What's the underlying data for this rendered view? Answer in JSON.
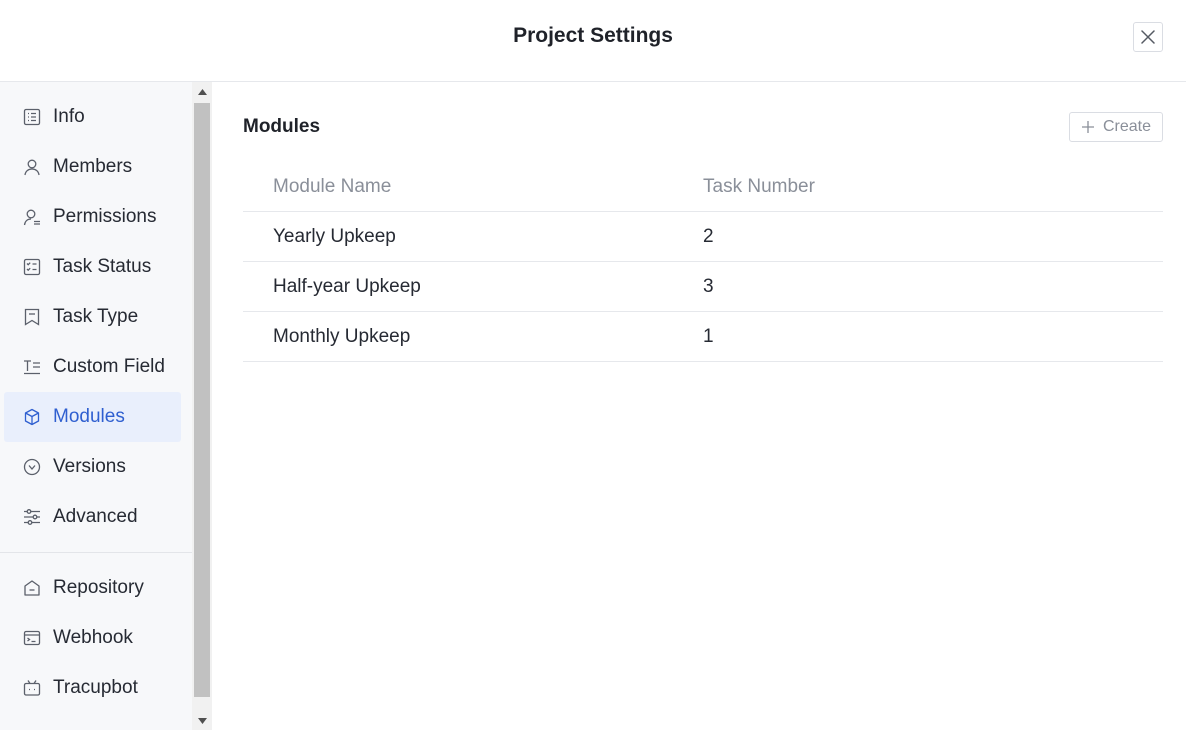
{
  "header": {
    "title": "Project Settings",
    "close_icon": "close-icon"
  },
  "sidebar": {
    "items": [
      {
        "label": "Info",
        "icon": "info-list-icon",
        "active": false
      },
      {
        "label": "Members",
        "icon": "user-icon",
        "active": false
      },
      {
        "label": "Permissions",
        "icon": "user-permission-icon",
        "active": false
      },
      {
        "label": "Task Status",
        "icon": "task-status-icon",
        "active": false
      },
      {
        "label": "Task Type",
        "icon": "bookmark-icon",
        "active": false
      },
      {
        "label": "Custom Field",
        "icon": "custom-field-icon",
        "active": false
      },
      {
        "label": "Modules",
        "icon": "cube-icon",
        "active": true
      },
      {
        "label": "Versions",
        "icon": "chevron-circle-icon",
        "active": false
      },
      {
        "label": "Advanced",
        "icon": "sliders-icon",
        "active": false
      }
    ],
    "secondary_items": [
      {
        "label": "Repository",
        "icon": "repository-icon"
      },
      {
        "label": "Webhook",
        "icon": "terminal-icon"
      },
      {
        "label": "Tracupbot",
        "icon": "bot-icon"
      }
    ]
  },
  "main": {
    "section_title": "Modules",
    "create_label": "Create",
    "table": {
      "columns": [
        "Module Name",
        "Task Number"
      ],
      "rows": [
        {
          "name": "Yearly Upkeep",
          "tasks": "2"
        },
        {
          "name": "Half-year Upkeep",
          "tasks": "3"
        },
        {
          "name": "Monthly Upkeep",
          "tasks": "1"
        }
      ]
    }
  },
  "colors": {
    "accent": "#2f5fd0",
    "active_bg": "#e9effc",
    "sidebar_bg": "#f7f8fa"
  }
}
